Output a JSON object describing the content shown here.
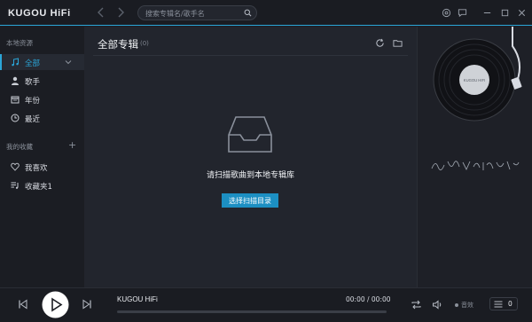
{
  "app": {
    "logo": "KUGOU HiFi",
    "search_placeholder": "搜索专辑名/歌手名"
  },
  "sidebar": {
    "local_title": "本地资源",
    "local_items": [
      {
        "label": "全部",
        "icon": "music-note-icon",
        "active": true
      },
      {
        "label": "歌手",
        "icon": "person-icon"
      },
      {
        "label": "年份",
        "icon": "calendar-icon"
      },
      {
        "label": "最近",
        "icon": "clock-icon"
      }
    ],
    "favorites_title": "我的收藏",
    "favorite_items": [
      {
        "label": "我喜欢",
        "icon": "heart-icon"
      },
      {
        "label": "收藏夹1",
        "icon": "playlist-icon"
      }
    ]
  },
  "main": {
    "title": "全部专辑",
    "count": "(0)",
    "empty_message": "请扫描歌曲到本地专辑库",
    "scan_button": "选择扫描目录"
  },
  "record_label": "KUGOU HIFI",
  "player": {
    "track_title": "KUGOU HiFi",
    "time": "00:00 / 00:00",
    "progress": 0,
    "quality_label": "音效",
    "queue_count": "0"
  },
  "colors": {
    "accent": "#2ba6d8",
    "button": "#1c8fc2",
    "background": "#22252d",
    "sidebar": "#1b1d23"
  }
}
